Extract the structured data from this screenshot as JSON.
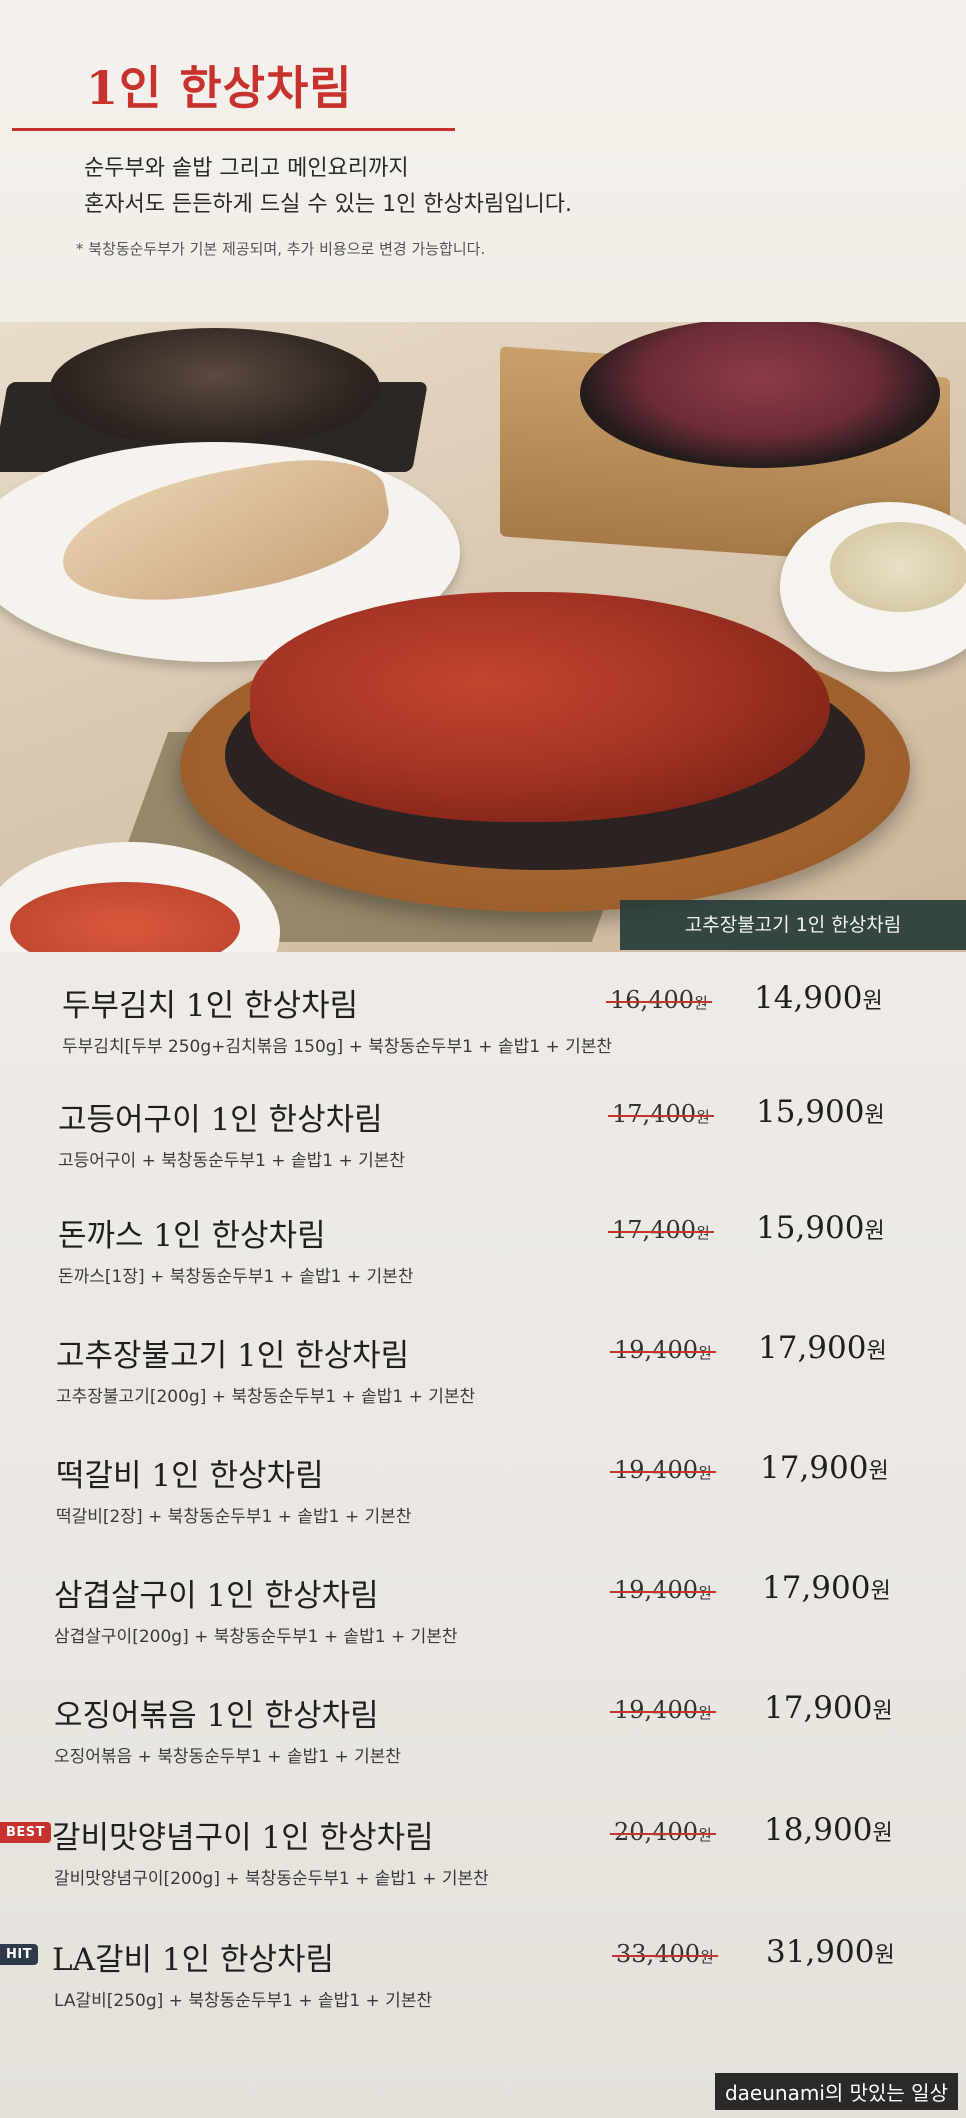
{
  "header": {
    "title": "1인 한상차림",
    "intro_line1": "순두부와 솥밥 그리고 메인요리까지",
    "intro_line2": "혼자서도 든든하게 드실 수 있는 1인 한상차림입니다.",
    "note": "* 북창동순두부가 기본 제공되며, 추가 비용으로 변경 가능합니다."
  },
  "photo": {
    "caption": "고추장불고기 1인 한상차림"
  },
  "menu": [
    {
      "name": "두부김치 1인 한상차림",
      "desc": "두부김치[두부 250g+김치볶음 150g] + 북창동순두부1 + 솥밥1 + 기본찬",
      "old_price": "16,400",
      "new_price": "14,900",
      "won": "원"
    },
    {
      "name": "고등어구이 1인 한상차림",
      "desc": "고등어구이 + 북창동순두부1 + 솥밥1 + 기본찬",
      "old_price": "17,400",
      "new_price": "15,900",
      "won": "원"
    },
    {
      "name": "돈까스 1인 한상차림",
      "desc": "돈까스[1장] + 북창동순두부1 + 솥밥1 + 기본찬",
      "old_price": "17,400",
      "new_price": "15,900",
      "won": "원"
    },
    {
      "name": "고추장불고기 1인 한상차림",
      "desc": "고추장불고기[200g] + 북창동순두부1 + 솥밥1 + 기본찬",
      "old_price": "19,400",
      "new_price": "17,900",
      "won": "원"
    },
    {
      "name": "떡갈비 1인 한상차림",
      "desc": "떡갈비[2장] + 북창동순두부1 + 솥밥1 + 기본찬",
      "old_price": "19,400",
      "new_price": "17,900",
      "won": "원"
    },
    {
      "name": "삼겹살구이 1인 한상차림",
      "desc": "삼겹살구이[200g] + 북창동순두부1 + 솥밥1 + 기본찬",
      "old_price": "19,400",
      "new_price": "17,900",
      "won": "원"
    },
    {
      "name": "오징어볶음 1인 한상차림",
      "desc": "오징어볶음 + 북창동순두부1 + 솥밥1 + 기본찬",
      "old_price": "19,400",
      "new_price": "17,900",
      "won": "원"
    },
    {
      "name": "갈비맛양념구이 1인 한상차림",
      "desc": "갈비맛양념구이[200g] + 북창동순두부1 + 솥밥1 + 기본찬",
      "old_price": "20,400",
      "new_price": "18,900",
      "won": "원",
      "badge": "BEST"
    },
    {
      "name": "LA갈비 1인 한상차림",
      "desc": "LA갈비[250g] + 북창동순두부1 + 솥밥1 + 기본찬",
      "old_price": "33,400",
      "new_price": "31,900",
      "won": "원",
      "badge": "HIT"
    }
  ],
  "watermark": "daeunami의 맛있는 일상",
  "colors": {
    "accent": "#c8322c",
    "caption_bg": "#263c38",
    "hit_badge": "#2c3a4a"
  }
}
